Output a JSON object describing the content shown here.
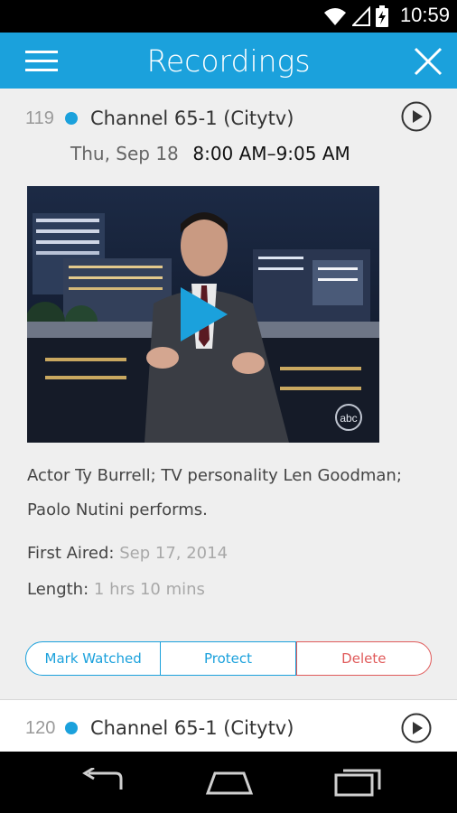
{
  "status_bar": {
    "time": "10:59"
  },
  "app_bar": {
    "title": "Recordings"
  },
  "recordings": [
    {
      "number": "119",
      "channel": "Channel 65-1 (Citytv)",
      "date": "Thu, Sep 18",
      "time": "8:00 AM–9:05 AM",
      "description_line1": "Actor Ty Burrell; TV personality Len Goodman;",
      "description_line2": "Paolo Nutini performs.",
      "first_aired_label": "First Aired:",
      "first_aired_value": "Sep 17, 2014",
      "length_label": "Length:",
      "length_value": "1 hrs 10 mins",
      "actions": {
        "mark_watched": "Mark Watched",
        "protect": "Protect",
        "delete": "Delete"
      },
      "thumbnail_watermark": "abc"
    },
    {
      "number": "120",
      "channel": "Channel 65-1 (Citytv)"
    }
  ],
  "colors": {
    "accent": "#1ba1dc",
    "delete": "#e05a5a"
  }
}
